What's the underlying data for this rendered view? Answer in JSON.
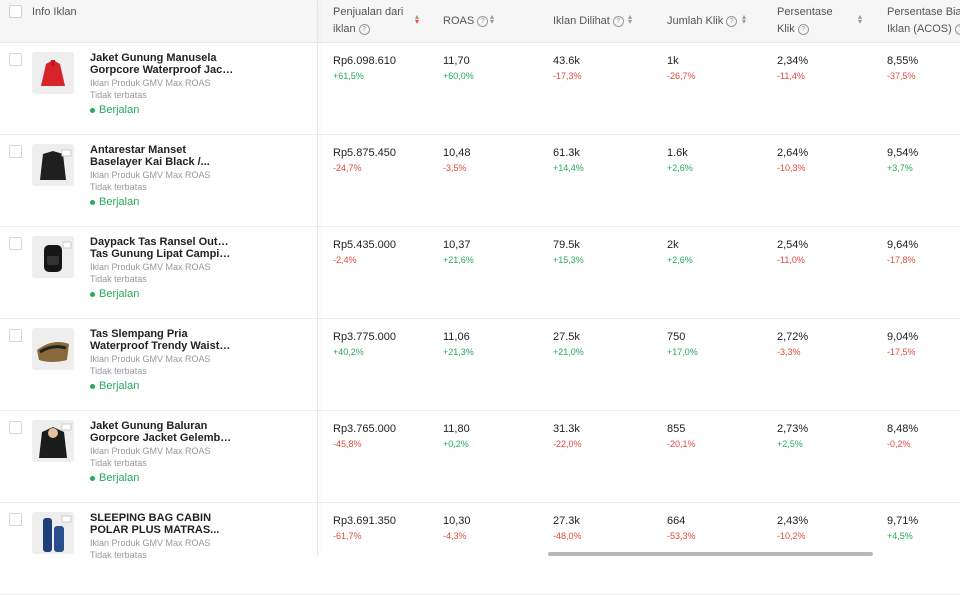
{
  "header": {
    "info": "Info Iklan",
    "sales_1": "Penjualan dari",
    "sales_2": "iklan",
    "roas": "ROAS",
    "views": "Iklan Dilihat",
    "clicks": "Jumlah Klik",
    "ctr_1": "Persentase",
    "ctr_2": "Klik",
    "acos_1": "Persentase Biaya",
    "acos_2": "Iklan (ACOS)"
  },
  "colors": {
    "positive": "#26aa5c",
    "negative": "#e04a3a",
    "sort_active": "#ee4d2d"
  },
  "rows": [
    {
      "name1": "Jaket Gunung Manusela",
      "name2": "Gorpcore Waterproof Jack...",
      "type": "Iklan Produk GMV Max ROAS",
      "budget": "Tidak terbatas",
      "status": "Berjalan",
      "thumb_icon": "red-jacket-image",
      "sales": "Rp6.098.610",
      "sales_chg": "+61,5%",
      "roas": "11,70",
      "roas_chg": "+60,0%",
      "views": "43.6k",
      "views_chg": "-17,3%",
      "clicks": "1k",
      "clicks_chg": "-26,7%",
      "ctr": "2,34%",
      "ctr_chg": "-11,4%",
      "acos": "8,55%",
      "acos_chg": "-37,5%"
    },
    {
      "name1": "Antarestar Manset",
      "name2": "Baselayer Kai Black /...",
      "type": "Iklan Produk GMV Max ROAS",
      "budget": "Tidak terbatas",
      "status": "Berjalan",
      "thumb_icon": "black-baselayer-image",
      "sales": "Rp5.875.450",
      "sales_chg": "-24,7%",
      "roas": "10,48",
      "roas_chg": "-3,5%",
      "views": "61.3k",
      "views_chg": "+14,4%",
      "clicks": "1.6k",
      "clicks_chg": "+2,6%",
      "ctr": "2,64%",
      "ctr_chg": "-10,3%",
      "acos": "9,54%",
      "acos_chg": "+3,7%"
    },
    {
      "name1": "Daypack Tas Ransel Outdoor",
      "name2": "Tas Gunung Lipat Camping...",
      "type": "Iklan Produk GMV Max ROAS",
      "budget": "Tidak terbatas",
      "status": "Berjalan",
      "thumb_icon": "backpack-image",
      "sales": "Rp5.435.000",
      "sales_chg": "-2,4%",
      "roas": "10,37",
      "roas_chg": "+21,6%",
      "views": "79.5k",
      "views_chg": "+15,3%",
      "clicks": "2k",
      "clicks_chg": "+2,6%",
      "ctr": "2,54%",
      "ctr_chg": "-11,0%",
      "acos": "9,64%",
      "acos_chg": "-17,8%"
    },
    {
      "name1": "Tas Slempang Pria",
      "name2": "Waterproof Trendy Waistb...",
      "type": "Iklan Produk GMV Max ROAS",
      "budget": "Tidak terbatas",
      "status": "Berjalan",
      "thumb_icon": "sling-bag-image",
      "sales": "Rp3.775.000",
      "sales_chg": "+40,2%",
      "roas": "11,06",
      "roas_chg": "+21,3%",
      "views": "27.5k",
      "views_chg": "+21,0%",
      "clicks": "750",
      "clicks_chg": "+17,0%",
      "ctr": "2,72%",
      "ctr_chg": "-3,3%",
      "acos": "9,04%",
      "acos_chg": "-17,5%"
    },
    {
      "name1": "Jaket Gunung Baluran",
      "name2": "Gorpcore Jacket Gelembu...",
      "type": "Iklan Produk GMV Max ROAS",
      "budget": "Tidak terbatas",
      "status": "Berjalan",
      "thumb_icon": "black-jacket-image",
      "sales": "Rp3.765.000",
      "sales_chg": "-45,8%",
      "roas": "11,80",
      "roas_chg": "+0,2%",
      "views": "31.3k",
      "views_chg": "-22,0%",
      "clicks": "855",
      "clicks_chg": "-20,1%",
      "ctr": "2,73%",
      "ctr_chg": "+2,5%",
      "acos": "8,48%",
      "acos_chg": "-0,2%"
    },
    {
      "name1": "SLEEPING BAG CABIN",
      "name2": "POLAR PLUS MATRAS...",
      "type": "Iklan Produk GMV Max ROAS",
      "budget": "Tidak terbatas",
      "status": "",
      "thumb_icon": "sleeping-bag-image",
      "sales": "Rp3.691.350",
      "sales_chg": "-61,7%",
      "roas": "10,30",
      "roas_chg": "-4,3%",
      "views": "27.3k",
      "views_chg": "-48,0%",
      "clicks": "664",
      "clicks_chg": "-53,3%",
      "ctr": "2,43%",
      "ctr_chg": "-10,2%",
      "acos": "9,71%",
      "acos_chg": "+4,5%"
    }
  ]
}
